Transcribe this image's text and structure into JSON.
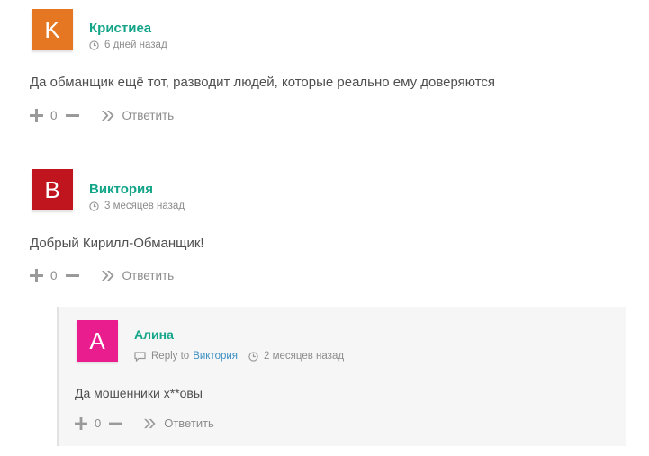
{
  "comments": [
    {
      "avatar_letter": "K",
      "avatar_color": "#e67722",
      "author": "Кристиеа",
      "time": "6 дней назад",
      "text": "Да обманщик ещё тот, разводит людей, которые реально ему доверяются",
      "votes": "0",
      "reply_label": "Ответить"
    },
    {
      "avatar_letter": "B",
      "avatar_color": "#c0151f",
      "author": "Виктория",
      "time": "3 месяцев назад",
      "text": "Добрый Кирилл-Обманщик!",
      "votes": "0",
      "reply_label": "Ответить"
    }
  ],
  "reply": {
    "avatar_letter": "A",
    "avatar_color": "#ea1d8f",
    "author": "Алина",
    "reply_to_label": "Reply to",
    "reply_to_name": "Виктория",
    "time": "2 месяцев назад",
    "text": "Да мошенники х**овы",
    "votes": "0",
    "reply_label": "Ответить"
  },
  "icons": {
    "clock": "clock-icon",
    "plus": "plus-icon",
    "minus": "minus-icon",
    "reply": "reply-arrow-icon",
    "speech": "speech-bubble-icon"
  }
}
